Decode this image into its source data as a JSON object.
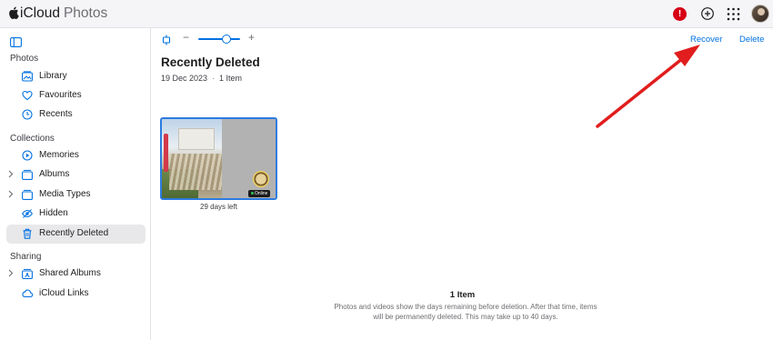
{
  "header": {
    "brand_icloud": "iCloud",
    "brand_photos": "Photos",
    "alert_glyph": "!",
    "icons": [
      "apple-logo-icon",
      "alert-icon",
      "add-icon",
      "apps-grid-icon",
      "avatar"
    ]
  },
  "sidebar": {
    "sections": [
      {
        "title": "Photos"
      },
      {
        "title": "Collections"
      },
      {
        "title": "Sharing"
      }
    ],
    "items": [
      {
        "label": "Library",
        "icon": "library-icon"
      },
      {
        "label": "Favourites",
        "icon": "heart-icon"
      },
      {
        "label": "Recents",
        "icon": "clock-icon"
      },
      {
        "label": "Memories",
        "icon": "memories-icon"
      },
      {
        "label": "Albums",
        "icon": "albums-icon",
        "expandable": true
      },
      {
        "label": "Media Types",
        "icon": "media-types-icon",
        "expandable": true
      },
      {
        "label": "Hidden",
        "icon": "eye-icon"
      },
      {
        "label": "Recently Deleted",
        "icon": "trash-icon",
        "selected": true
      },
      {
        "label": "Shared Albums",
        "icon": "shared-albums-icon",
        "expandable": true
      },
      {
        "label": "iCloud Links",
        "icon": "cloud-link-icon"
      }
    ]
  },
  "toolbar": {
    "zoom_minus": "−",
    "zoom_plus": "+",
    "zoom_level": 0.6,
    "recover_label": "Recover",
    "delete_label": "Delete"
  },
  "main": {
    "title": "Recently Deleted",
    "date": "19 Dec 2023",
    "separator": "·",
    "item_count": "1 Item",
    "thumbnails": [
      {
        "caption": "29 days left",
        "badge": "Online"
      }
    ],
    "footer": {
      "count": "1 Item",
      "description": "Photos and videos show the days remaining before deletion. After that time, items will be permanently deleted. This may take up to 40 days."
    }
  },
  "colors": {
    "accent": "#0071e3",
    "selection_border": "#2d7be0",
    "alert": "#d70015",
    "annotation_arrow": "#e11d1d"
  }
}
